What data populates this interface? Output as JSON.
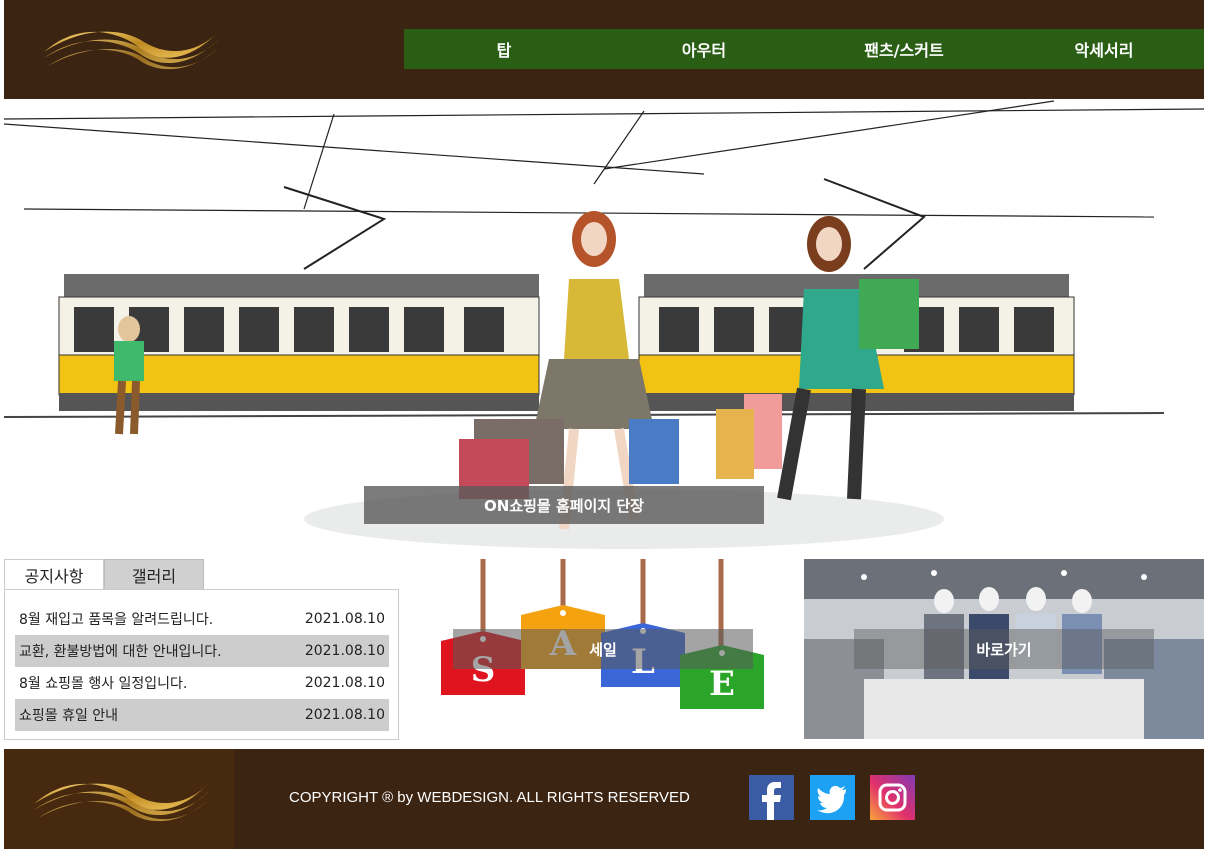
{
  "header": {
    "nav": [
      "탑",
      "아우터",
      "팬츠/스커트",
      "악세서리"
    ]
  },
  "hero": {
    "caption": "ON쇼핑몰 홈페이지 단장"
  },
  "notice": {
    "tabs": [
      "공지사항",
      "갤러리"
    ],
    "items": [
      {
        "title": "8월 재입고 품목을 알려드립니다.",
        "date": "2021.08.10"
      },
      {
        "title": "교환, 환불방법에 대한 안내입니다.",
        "date": "2021.08.10"
      },
      {
        "title": "8월 쇼핑몰 행사 일정입니다.",
        "date": "2021.08.10"
      },
      {
        "title": "쇼핑몰 휴일 안내",
        "date": "2021.08.10"
      }
    ]
  },
  "sale": {
    "label": "세일",
    "tags": [
      "S",
      "A",
      "L",
      "E"
    ],
    "tag_colors": [
      "#e0141e",
      "#f4a210",
      "#3a66d8",
      "#2aa52a"
    ]
  },
  "store": {
    "label": "바로가기"
  },
  "footer": {
    "copyright": "COPYRIGHT ® by WEBDESIGN. ALL RIGHTS RESERVED",
    "social": [
      "facebook-icon",
      "twitter-icon",
      "instagram-icon"
    ]
  },
  "colors": {
    "header_bg": "#3c2412",
    "nav_bg": "#2a5e15",
    "accent_gold": "#c8962e"
  }
}
